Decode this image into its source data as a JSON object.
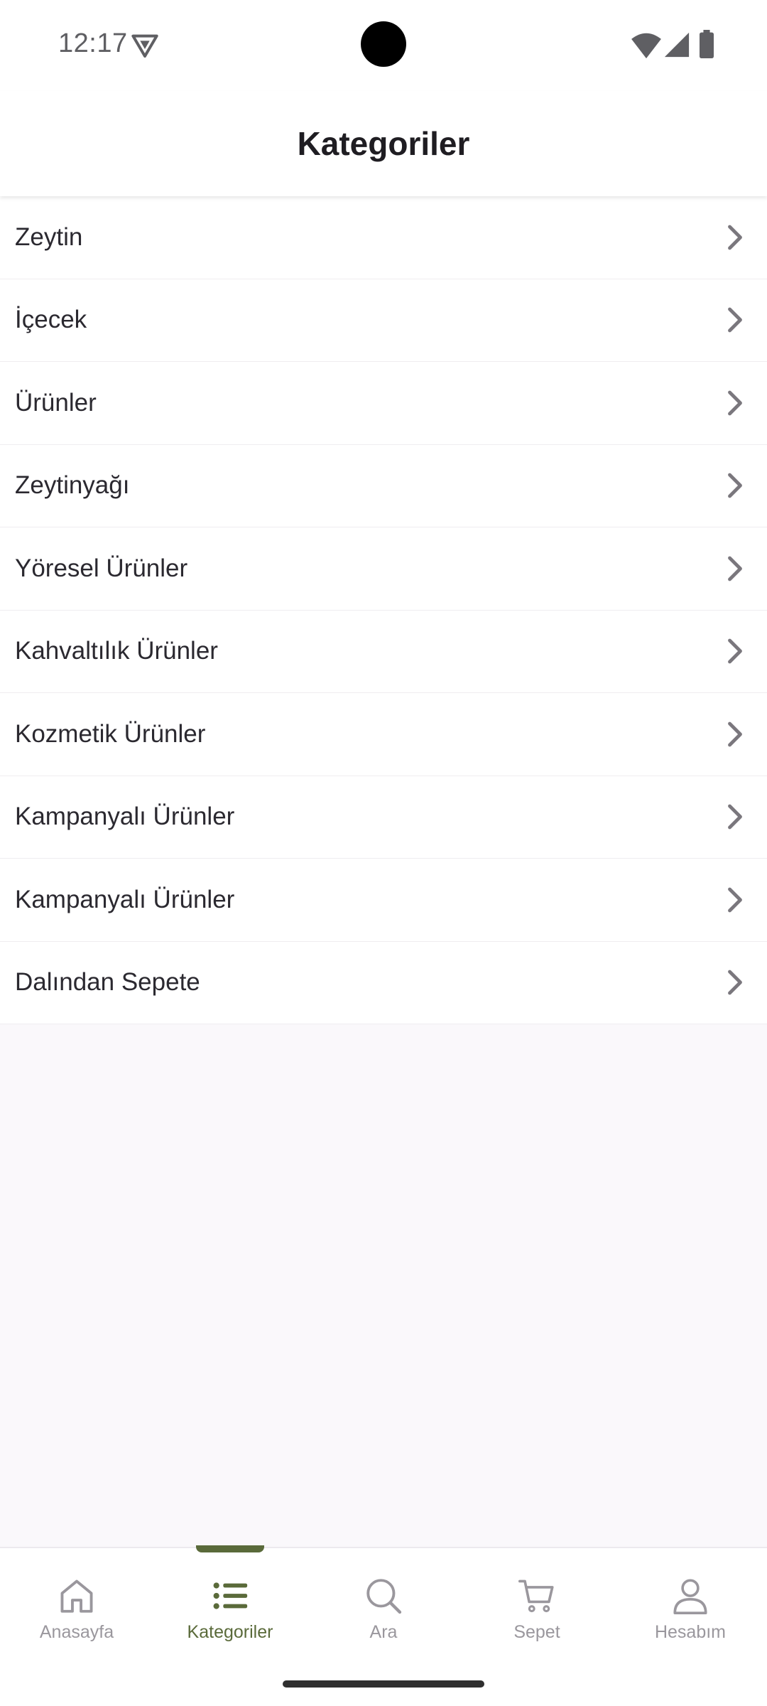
{
  "status_bar": {
    "time": "12:17",
    "icons": [
      "vpn-icon",
      "wifi-icon",
      "signal-icon",
      "battery-icon"
    ]
  },
  "header": {
    "title": "Kategoriler"
  },
  "categories": [
    {
      "label": "Zeytin"
    },
    {
      "label": "İçecek"
    },
    {
      "label": "Ürünler"
    },
    {
      "label": "Zeytinyağı"
    },
    {
      "label": "Yöresel Ürünler"
    },
    {
      "label": "Kahvaltılık Ürünler"
    },
    {
      "label": "Kozmetik Ürünler"
    },
    {
      "label": "Kampanyalı Ürünler"
    },
    {
      "label": "Kampanyalı Ürünler"
    },
    {
      "label": "Dalından Sepete"
    }
  ],
  "bottom_nav": {
    "items": [
      {
        "label": "Anasayfa",
        "icon": "home-icon"
      },
      {
        "label": "Kategoriler",
        "icon": "list-icon",
        "active": true
      },
      {
        "label": "Ara",
        "icon": "search-icon"
      },
      {
        "label": "Sepet",
        "icon": "cart-icon"
      },
      {
        "label": "Hesabım",
        "icon": "account-icon"
      }
    ]
  },
  "colors": {
    "accent": "#5a6a3a",
    "inactive": "#9a979d",
    "background": "#faf8fb",
    "text": "#2b2930"
  }
}
